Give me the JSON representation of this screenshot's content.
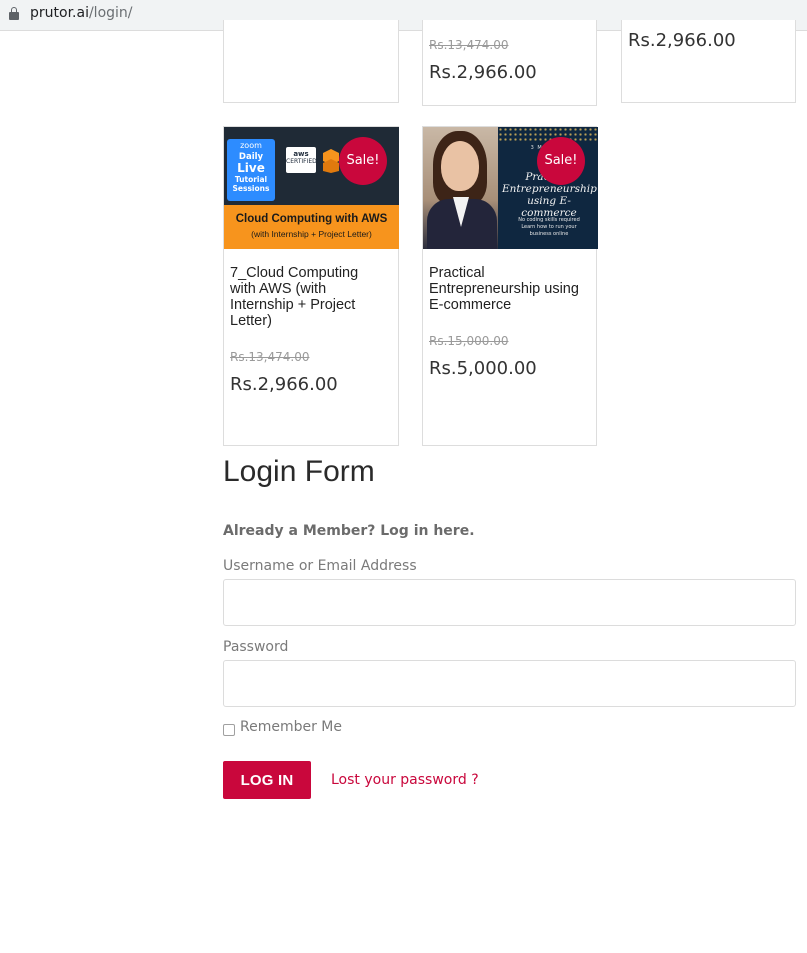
{
  "browser": {
    "url_host": "prutor.ai",
    "url_path": "/login/"
  },
  "top_cards": [
    {
      "old_price": "",
      "new_price": ""
    },
    {
      "old_price": "Rs.13,474.00",
      "new_price": "Rs.2,966.00"
    },
    {
      "old_price": "",
      "new_price": "Rs.2,966.00"
    }
  ],
  "products": [
    {
      "title_lines": [
        "7_Cloud Computing",
        "with AWS (with",
        "Internship + Project",
        "Letter)"
      ],
      "old_price": "Rs.13,474.00",
      "new_price": "Rs.2,966.00",
      "sale_badge": "Sale!",
      "thumb": {
        "zoom": "zoom",
        "line1": "Daily",
        "line2": "Live",
        "line3": "Tutorial",
        "line4": "Sessions",
        "cert_top": "aws",
        "cert_mid": "CERTIFIED",
        "banner_title": "Cloud Computing with AWS",
        "banner_sub": "(with Internship + Project Letter)"
      }
    },
    {
      "title_lines": [
        "Practical",
        "Entrepreneurship using",
        "E-commerce"
      ],
      "old_price": "Rs.15,000.00",
      "new_price": "Rs.5,000.00",
      "sale_badge": "Sale!",
      "thumb": {
        "top_small": "3 MONTHS",
        "script_line1": "Practical",
        "script_line2": "Entrepreneurship",
        "script_line3": "using E-commerce",
        "foot1": "No coding skills required",
        "foot2": "Learn how to run your",
        "foot3": "business online"
      }
    }
  ],
  "login": {
    "title": "Login Form",
    "member_text": "Already a Member? Log in here.",
    "username_label": "Username or Email Address",
    "username_value": "",
    "password_label": "Password",
    "password_value": "",
    "remember_label": "Remember Me",
    "button_label": "LOG IN",
    "lost_password": "Lost your password ?"
  },
  "colors": {
    "accent": "#c9073c",
    "border": "#dddddd"
  }
}
